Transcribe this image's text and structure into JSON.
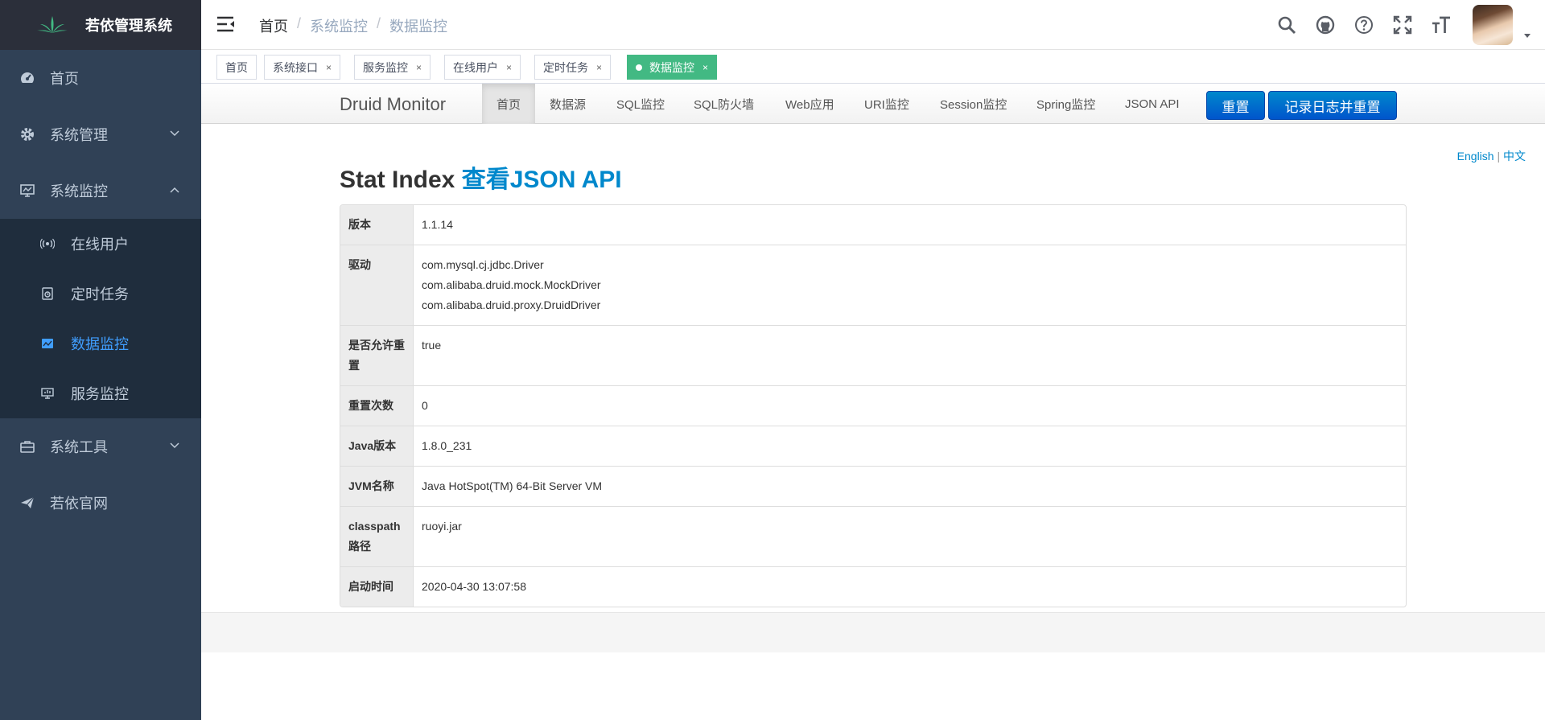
{
  "app": {
    "title": "若依管理系统"
  },
  "sidebar": {
    "items": [
      {
        "label": "首页",
        "icon": "dashboard-icon"
      },
      {
        "label": "系统管理",
        "icon": "gear-icon",
        "expanded": false
      },
      {
        "label": "系统监控",
        "icon": "monitor-icon",
        "expanded": true,
        "children": [
          {
            "label": "在线用户",
            "icon": "online-icon"
          },
          {
            "label": "定时任务",
            "icon": "job-icon"
          },
          {
            "label": "数据监控",
            "icon": "druid-icon",
            "active": true
          },
          {
            "label": "服务监控",
            "icon": "server-icon"
          }
        ]
      },
      {
        "label": "系统工具",
        "icon": "toolbox-icon",
        "expanded": false
      },
      {
        "label": "若依官网",
        "icon": "send-icon"
      }
    ]
  },
  "breadcrumb": [
    "首页",
    "系统监控",
    "数据监控"
  ],
  "tags": [
    {
      "label": "首页",
      "closable": false
    },
    {
      "label": "系统接口",
      "closable": true
    },
    {
      "label": "服务监控",
      "closable": true
    },
    {
      "label": "在线用户",
      "closable": true
    },
    {
      "label": "定时任务",
      "closable": true
    },
    {
      "label": "数据监控",
      "closable": true,
      "active": true
    }
  ],
  "tag_close_glyph": "×",
  "druid": {
    "brand": "Druid Monitor",
    "nav": [
      "首页",
      "数据源",
      "SQL监控",
      "SQL防火墙",
      "Web应用",
      "URI监控",
      "Session监控",
      "Spring监控",
      "JSON API"
    ],
    "buttons": {
      "reset": "重置",
      "log_reset": "记录日志并重置"
    },
    "lang": {
      "english": "English",
      "sep": "|",
      "chinese": "中文"
    },
    "title": "Stat Index",
    "title_link": "查看JSON API",
    "stats": [
      {
        "key": "版本",
        "lines": [
          "1.1.14"
        ]
      },
      {
        "key": "驱动",
        "lines": [
          "com.mysql.cj.jdbc.Driver",
          "com.alibaba.druid.mock.MockDriver",
          "com.alibaba.druid.proxy.DruidDriver"
        ]
      },
      {
        "key": "是否允许重置",
        "lines": [
          "true"
        ]
      },
      {
        "key": "重置次数",
        "lines": [
          "0"
        ]
      },
      {
        "key": "Java版本",
        "lines": [
          "1.8.0_231"
        ]
      },
      {
        "key": "JVM名称",
        "lines": [
          "Java HotSpot(TM) 64-Bit Server VM"
        ]
      },
      {
        "key": "classpath路径",
        "lines": [
          "ruoyi.jar"
        ]
      },
      {
        "key": "启动时间",
        "lines": [
          "2020-04-30 13:07:58"
        ]
      }
    ]
  },
  "colors": {
    "sidebar_bg": "#304156",
    "active_menu": "#409eff",
    "active_tag": "#42b983",
    "druid_btn": "#0066cc",
    "link": "#0088cc"
  }
}
